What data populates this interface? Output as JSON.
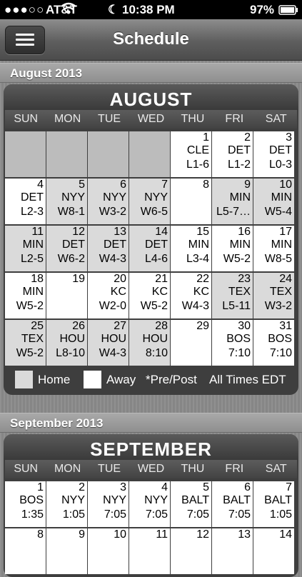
{
  "status": {
    "carrier": "AT&T",
    "time": "10:38 PM",
    "battery": "97%"
  },
  "nav": {
    "title": "Schedule"
  },
  "months": [
    {
      "section": "August 2013",
      "name": "AUGUST",
      "dows": [
        "SUN",
        "MON",
        "TUE",
        "WED",
        "THU",
        "FRI",
        "SAT"
      ],
      "weeks": [
        [
          {
            "type": "blank"
          },
          {
            "type": "blank"
          },
          {
            "type": "blank"
          },
          {
            "type": "blank"
          },
          {
            "type": "away",
            "day": "1",
            "opp": "CLE",
            "res": "L1-6"
          },
          {
            "type": "away",
            "day": "2",
            "opp": "DET",
            "res": "L1-2"
          },
          {
            "type": "away",
            "day": "3",
            "opp": "DET",
            "res": "L0-3"
          }
        ],
        [
          {
            "type": "away",
            "day": "4",
            "opp": "DET",
            "res": "L2-3"
          },
          {
            "type": "home",
            "day": "5",
            "opp": "NYY",
            "res": "W8-1"
          },
          {
            "type": "home",
            "day": "6",
            "opp": "NYY",
            "res": "W3-2"
          },
          {
            "type": "home",
            "day": "7",
            "opp": "NYY",
            "res": "W6-5"
          },
          {
            "type": "away",
            "day": "8",
            "opp": "",
            "res": ""
          },
          {
            "type": "home",
            "day": "9",
            "opp": "MIN",
            "res": "L5-7…"
          },
          {
            "type": "home",
            "day": "10",
            "opp": "MIN",
            "res": "W5-4"
          }
        ],
        [
          {
            "type": "home",
            "day": "11",
            "opp": "MIN",
            "res": "L2-5"
          },
          {
            "type": "home",
            "day": "12",
            "opp": "DET",
            "res": "W6-2"
          },
          {
            "type": "home",
            "day": "13",
            "opp": "DET",
            "res": "W4-3"
          },
          {
            "type": "home",
            "day": "14",
            "opp": "DET",
            "res": "L4-6"
          },
          {
            "type": "away",
            "day": "15",
            "opp": "MIN",
            "res": "L3-4"
          },
          {
            "type": "away",
            "day": "16",
            "opp": "MIN",
            "res": "W5-2"
          },
          {
            "type": "away",
            "day": "17",
            "opp": "MIN",
            "res": "W8-5"
          }
        ],
        [
          {
            "type": "away",
            "day": "18",
            "opp": "MIN",
            "res": "W5-2"
          },
          {
            "type": "away",
            "day": "19",
            "opp": "",
            "res": ""
          },
          {
            "type": "away",
            "day": "20",
            "opp": "KC",
            "res": "W2-0"
          },
          {
            "type": "away",
            "day": "21",
            "opp": "KC",
            "res": "W5-2"
          },
          {
            "type": "away",
            "day": "22",
            "opp": "KC",
            "res": "W4-3"
          },
          {
            "type": "home",
            "day": "23",
            "opp": "TEX",
            "res": "L5-11"
          },
          {
            "type": "home",
            "day": "24",
            "opp": "TEX",
            "res": "W3-2"
          }
        ],
        [
          {
            "type": "home",
            "day": "25",
            "opp": "TEX",
            "res": "W5-2"
          },
          {
            "type": "home",
            "day": "26",
            "opp": "HOU",
            "res": "L8-10"
          },
          {
            "type": "home",
            "day": "27",
            "opp": "HOU",
            "res": "W4-3"
          },
          {
            "type": "home",
            "day": "28",
            "opp": "HOU",
            "res": "8:10"
          },
          {
            "type": "away",
            "day": "29",
            "opp": "",
            "res": ""
          },
          {
            "type": "away",
            "day": "30",
            "opp": "BOS",
            "res": "7:10"
          },
          {
            "type": "away",
            "day": "31",
            "opp": "BOS",
            "res": "7:10"
          }
        ]
      ]
    },
    {
      "section": "September 2013",
      "name": "SEPTEMBER",
      "dows": [
        "SUN",
        "MON",
        "TUE",
        "WED",
        "THU",
        "FRI",
        "SAT"
      ],
      "weeks": [
        [
          {
            "type": "away",
            "day": "1",
            "opp": "BOS",
            "res": "1:35"
          },
          {
            "type": "away",
            "day": "2",
            "opp": "NYY",
            "res": "1:05"
          },
          {
            "type": "away",
            "day": "3",
            "opp": "NYY",
            "res": "7:05"
          },
          {
            "type": "away",
            "day": "4",
            "opp": "NYY",
            "res": "7:05"
          },
          {
            "type": "away",
            "day": "5",
            "opp": "BALT",
            "res": "7:05"
          },
          {
            "type": "away",
            "day": "6",
            "opp": "BALT",
            "res": "7:05"
          },
          {
            "type": "away",
            "day": "7",
            "opp": "BALT",
            "res": "1:05"
          }
        ],
        [
          {
            "type": "away",
            "day": "8",
            "opp": "",
            "res": ""
          },
          {
            "type": "away",
            "day": "9",
            "opp": "",
            "res": ""
          },
          {
            "type": "away",
            "day": "10",
            "opp": "",
            "res": ""
          },
          {
            "type": "away",
            "day": "11",
            "opp": "",
            "res": ""
          },
          {
            "type": "away",
            "day": "12",
            "opp": "",
            "res": ""
          },
          {
            "type": "away",
            "day": "13",
            "opp": "",
            "res": ""
          },
          {
            "type": "away",
            "day": "14",
            "opp": "",
            "res": ""
          }
        ]
      ]
    }
  ],
  "legend": {
    "home": "Home",
    "away": "Away",
    "prepost": "*Pre/Post",
    "times": "All Times EDT"
  }
}
